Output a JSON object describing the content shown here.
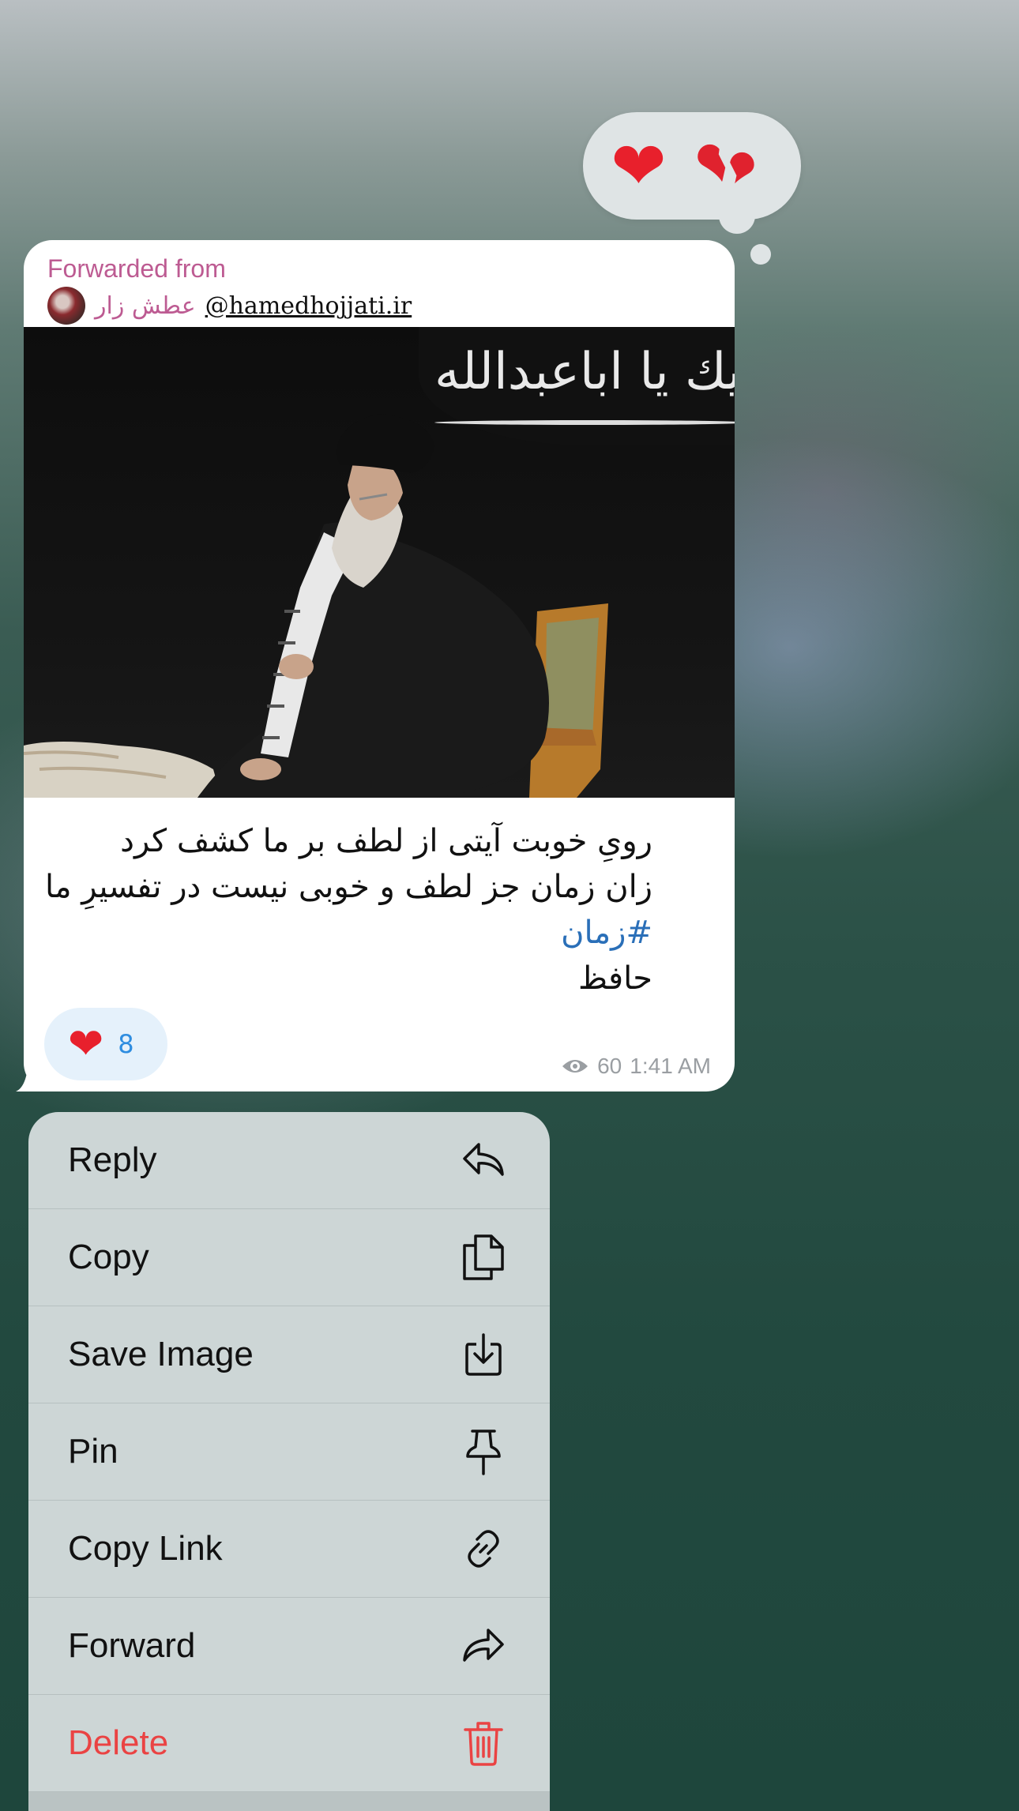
{
  "reactions_picker": {
    "items": [
      {
        "icon": "red-heart-icon",
        "glyph": "❤"
      },
      {
        "icon": "broken-heart-icon",
        "glyph": "❤"
      }
    ]
  },
  "message": {
    "forwarded_label": "Forwarded from",
    "source_name": "عطش زار",
    "source_handle": "@hamedhojjati.ir",
    "photo_banner_text": "لى الله عليك يا اباعبدالله",
    "caption_lines": [
      "رویِ خوبت آیتی از لطف بر ما کشف کرد",
      "زان زمان جز لطف و خوبی نیست در تفسیرِ ما"
    ],
    "hashtag": "#زمان",
    "caption_author": "حافظ",
    "reaction": {
      "glyph": "❤",
      "count": "8"
    },
    "views": "60",
    "time": "1:41 AM"
  },
  "menu": {
    "items": [
      {
        "label": "Reply",
        "icon": "reply-icon"
      },
      {
        "label": "Copy",
        "icon": "copy-icon"
      },
      {
        "label": "Save Image",
        "icon": "save-image-icon"
      },
      {
        "label": "Pin",
        "icon": "pin-icon"
      },
      {
        "label": "Copy Link",
        "icon": "link-icon"
      },
      {
        "label": "Forward",
        "icon": "forward-icon"
      },
      {
        "label": "Delete",
        "icon": "trash-icon"
      }
    ]
  },
  "colors": {
    "accent_forward": "#bd5b92",
    "hashtag": "#2a6fb8",
    "delete": "#ea4343",
    "reaction_count": "#2e8de0"
  }
}
